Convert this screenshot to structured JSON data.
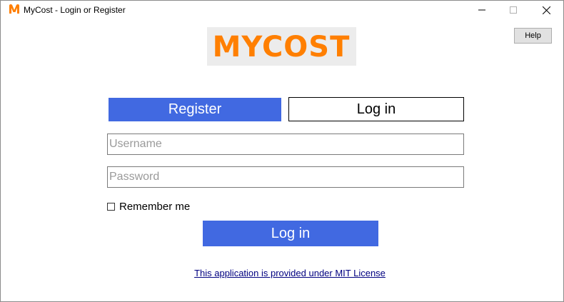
{
  "window": {
    "title": "MyCost - Login or Register",
    "icon": "mycost-m-icon"
  },
  "header": {
    "help_label": "Help",
    "logo_text": "MYCOST",
    "logo_color": "#ff7f00"
  },
  "tabs": [
    {
      "label": "Register",
      "active": true
    },
    {
      "label": "Log in",
      "active": false
    }
  ],
  "form": {
    "username_placeholder": "Username",
    "username_value": "",
    "password_placeholder": "Password",
    "password_value": "",
    "remember_label": "Remember me",
    "remember_checked": false,
    "login_label": "Log in"
  },
  "footer": {
    "license_text": "This application is provided under MIT License"
  },
  "colors": {
    "accent": "#4169e1",
    "logo": "#ff7f00"
  }
}
